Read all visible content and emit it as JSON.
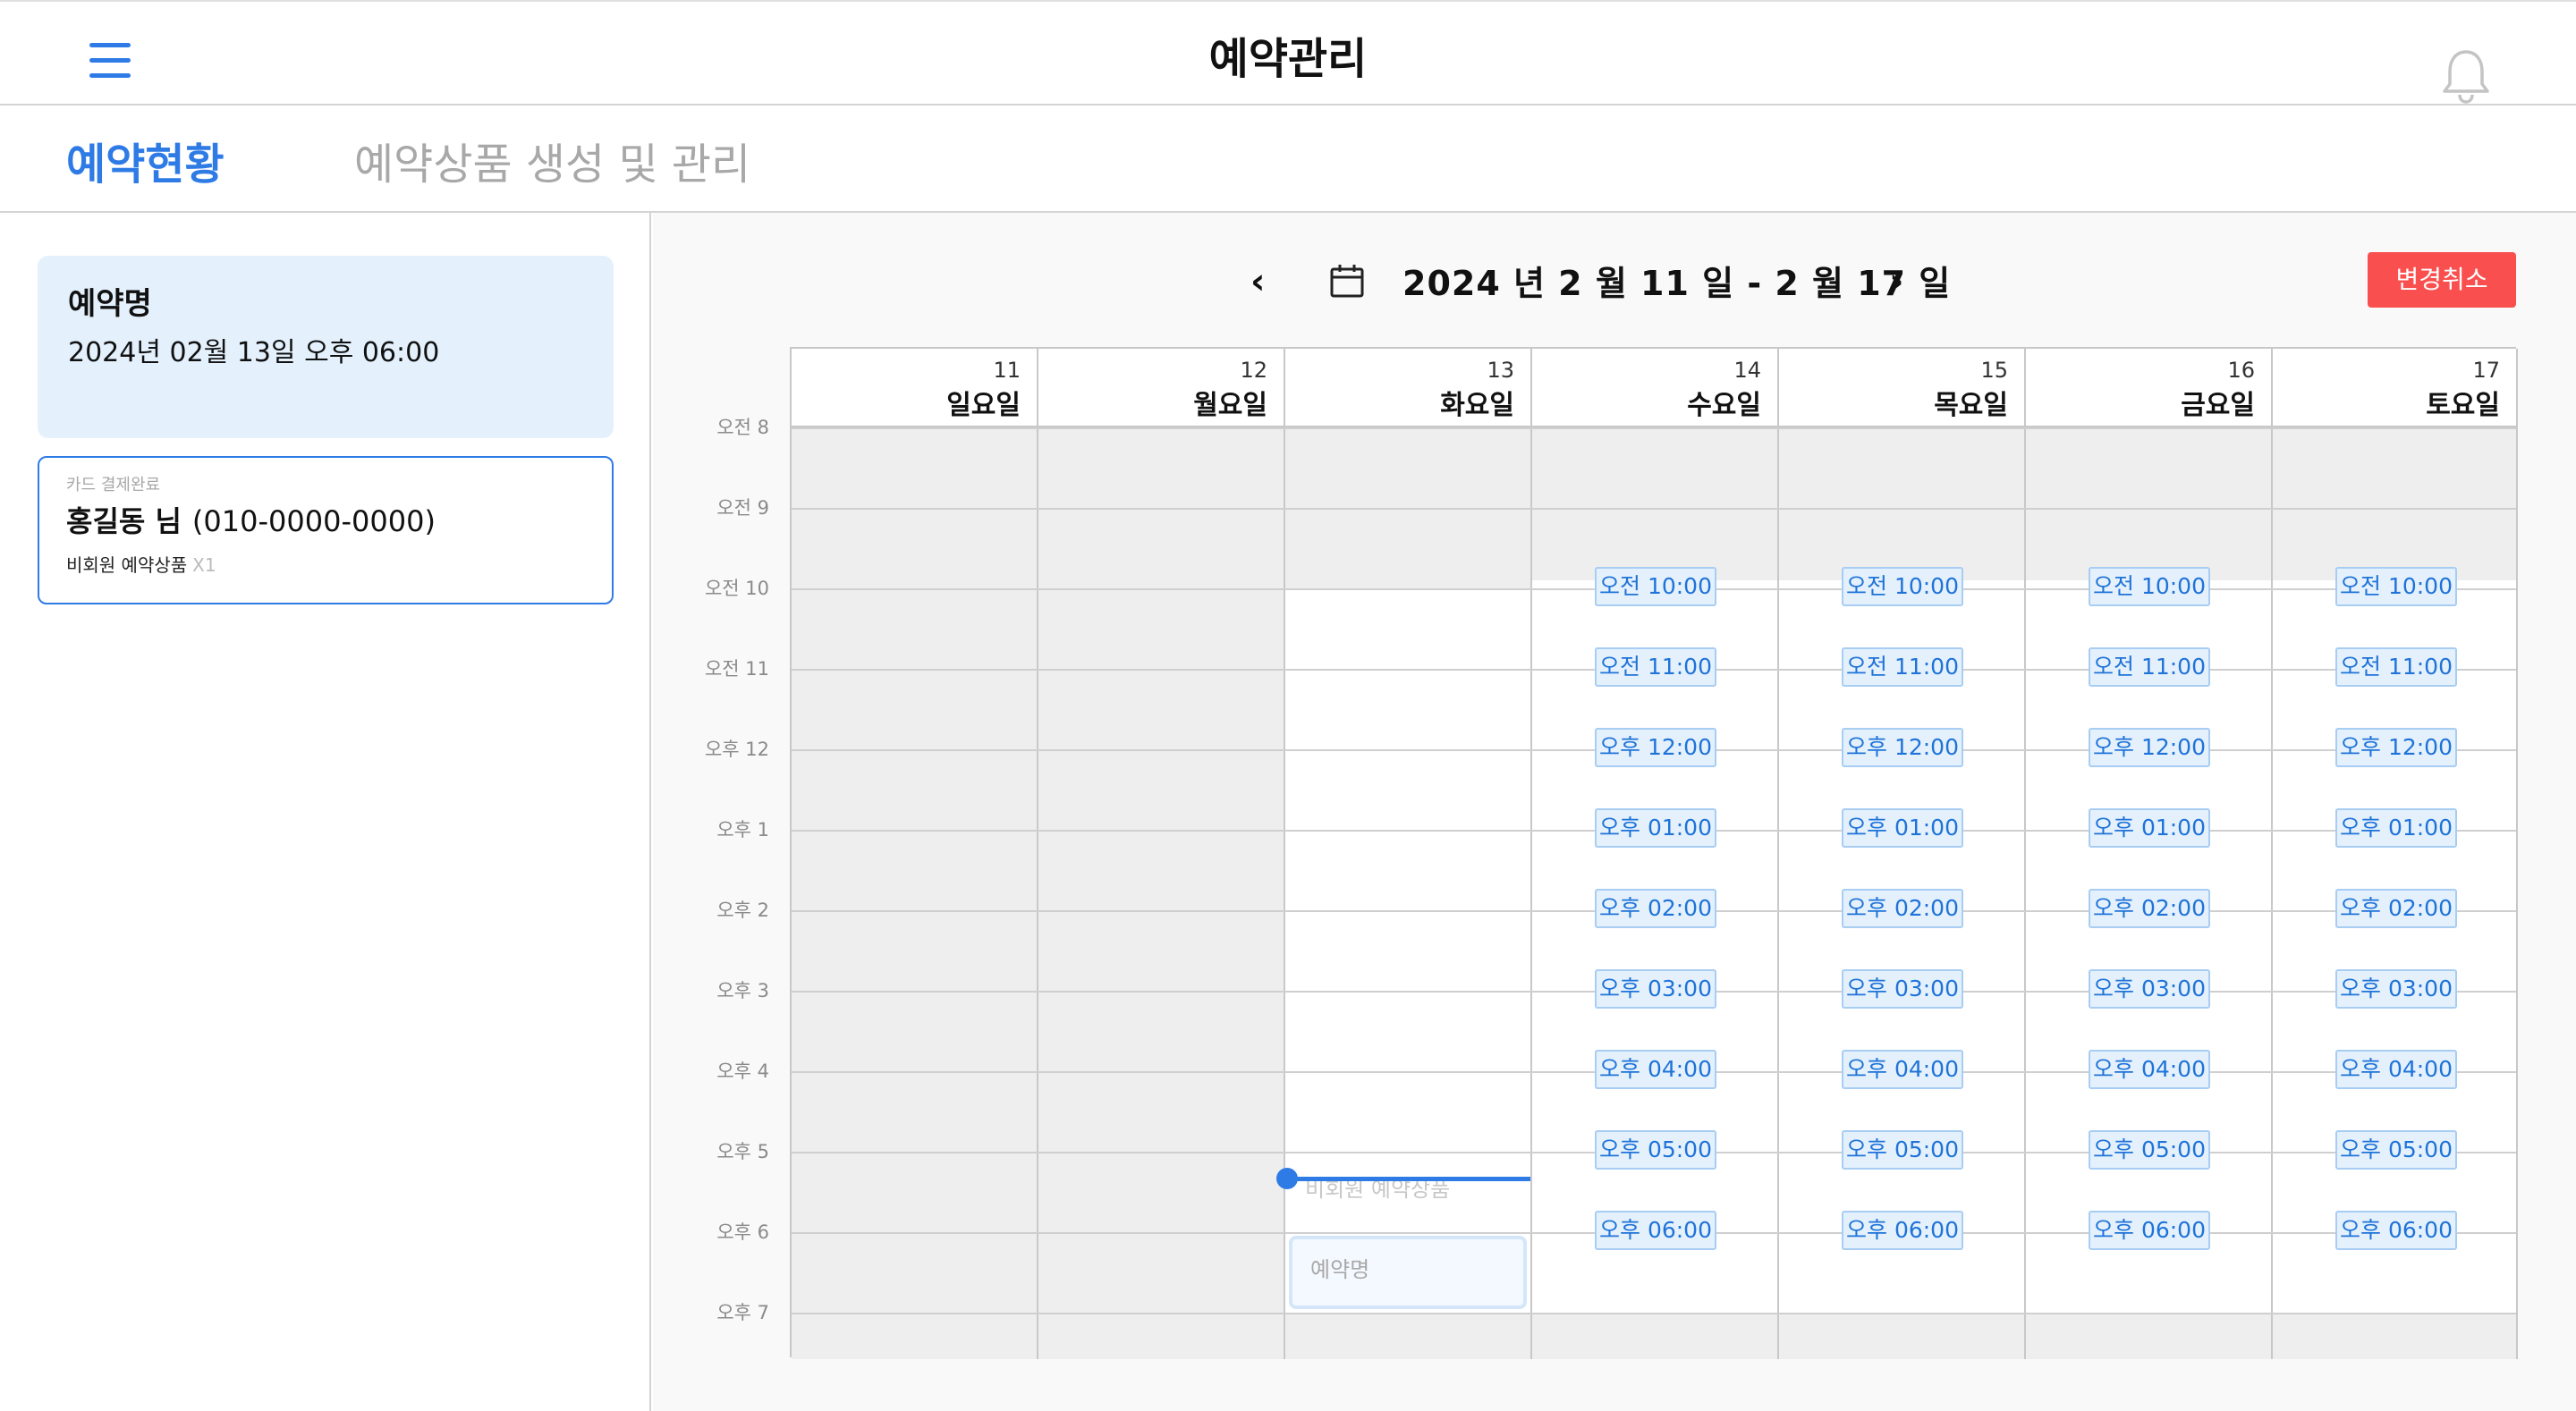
{
  "header": {
    "title": "예약관리",
    "menu_icon": "hamburger-icon",
    "notify_icon": "bell-icon"
  },
  "tabs": [
    {
      "label": "예약현황",
      "active": true
    },
    {
      "label": "예약상품 생성 및 관리",
      "active": false
    }
  ],
  "sidebar": {
    "reservation": {
      "name": "예약명",
      "datetime": "2024년 02월 13일  오후 06:00"
    },
    "customer": {
      "payment_status": "카드 결제완료",
      "name": "홍길동 님",
      "phone": "(010-0000-0000)",
      "product": "비회원 예약상품",
      "quantity": "X1"
    }
  },
  "calendar": {
    "range_label": "2024 년  2 월  11 일 - 2 월  17 일",
    "prev_icon": "chevron-left-icon",
    "next_icon": "chevron-right-icon",
    "date_icon": "calendar-icon",
    "cancel_label": "변경취소",
    "days": [
      {
        "num": "11",
        "name": "일요일"
      },
      {
        "num": "12",
        "name": "월요일"
      },
      {
        "num": "13",
        "name": "화요일"
      },
      {
        "num": "14",
        "name": "수요일"
      },
      {
        "num": "15",
        "name": "목요일"
      },
      {
        "num": "16",
        "name": "금요일"
      },
      {
        "num": "17",
        "name": "토요일"
      }
    ],
    "hours": [
      "오전 8",
      "오전 9",
      "오전 10",
      "오전 11",
      "오후 12",
      "오후 1",
      "오후 2",
      "오후 3",
      "오후 4",
      "오후 5",
      "오후 6",
      "오후 7"
    ],
    "slot_times": [
      "오전 10:00",
      "오전 11:00",
      "오후 12:00",
      "오후 01:00",
      "오후 02:00",
      "오후 03:00",
      "오후 04:00",
      "오후 05:00",
      "오후 06:00"
    ],
    "current_marker_label": "비회원 예약상품",
    "booking_label": "예약명",
    "colors": {
      "accent": "#2f7be6",
      "cancel": "#fa4f4f",
      "slot_bg": "#e4f1fd",
      "blocked_bg": "#eeeeee"
    }
  }
}
